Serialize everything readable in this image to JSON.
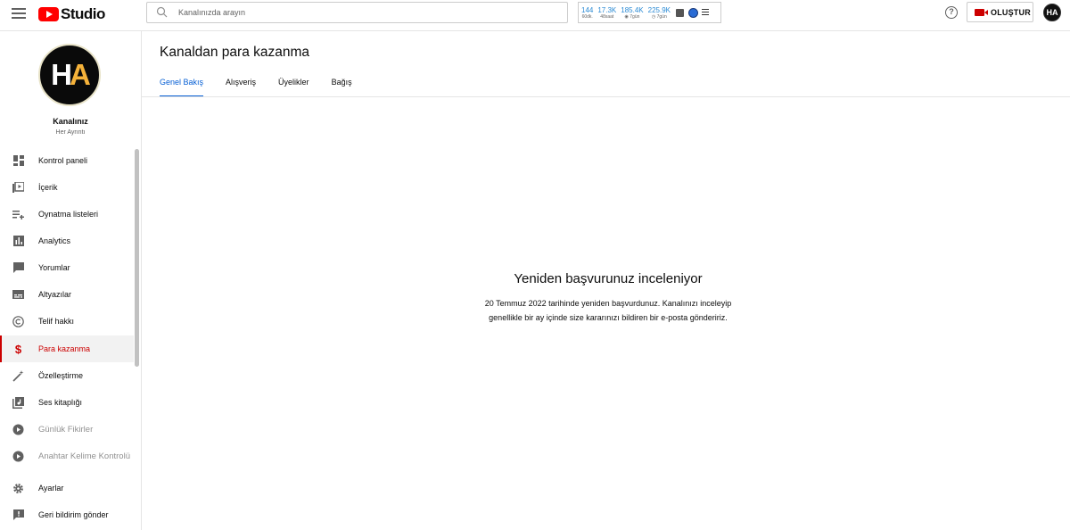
{
  "header": {
    "logo_text": "Studio",
    "search_placeholder": "Kanalınızda arayın",
    "stats": [
      {
        "value": "144",
        "label": "60dk."
      },
      {
        "value": "17.3K",
        "label": "48saat"
      },
      {
        "value": "185.4K",
        "label": "◉ 7gün"
      },
      {
        "value": "225.9K",
        "label": "◷ 7gün"
      }
    ],
    "help_icon_glyph": "?",
    "create_label": "OLUŞTUR",
    "avatar_initials": "HA"
  },
  "sidebar": {
    "channel_name": "Kanalınız",
    "channel_handle": "Her Ayrıntı",
    "avatar_initials_h": "H",
    "avatar_initials_a": "A",
    "items": [
      {
        "label": "Kontrol paneli",
        "icon": "dashboard-icon"
      },
      {
        "label": "İçerik",
        "icon": "content-icon"
      },
      {
        "label": "Oynatma listeleri",
        "icon": "playlist-icon"
      },
      {
        "label": "Analytics",
        "icon": "analytics-icon"
      },
      {
        "label": "Yorumlar",
        "icon": "comments-icon"
      },
      {
        "label": "Altyazılar",
        "icon": "subtitles-icon"
      },
      {
        "label": "Telif hakkı",
        "icon": "copyright-icon"
      },
      {
        "label": "Para kazanma",
        "icon": "dollar-icon",
        "active": true
      },
      {
        "label": "Özelleştirme",
        "icon": "customization-icon"
      },
      {
        "label": "Ses kitaplığı",
        "icon": "audio-library-icon"
      },
      {
        "label": "Günlük Fikirler",
        "icon": "extension-icon"
      },
      {
        "label": "Anahtar Kelime Kontrolü",
        "icon": "extension-icon"
      },
      {
        "label": "Ayarlar",
        "icon": "gear-icon"
      },
      {
        "label": "Geri bildirim gönder",
        "icon": "feedback-icon"
      }
    ]
  },
  "main": {
    "title": "Kanaldan para kazanma",
    "tabs": [
      {
        "label": "Genel Bakış",
        "active": true
      },
      {
        "label": "Alışveriş"
      },
      {
        "label": "Üyelikler"
      },
      {
        "label": "Bağış"
      }
    ],
    "status_title": "Yeniden başvurunuz inceleniyor",
    "status_text": "20 Temmuz 2022 tarihinde yeniden başvurdunuz. Kanalınızı inceleyip genellikle bir ay içinde size kararınızı bildiren bir e-posta göndeririz."
  },
  "colors": {
    "accent_red": "#cc0000",
    "tab_blue": "#065fd4",
    "stat_blue": "#2a8ad4",
    "avatar_yellow": "#f5b23a"
  }
}
